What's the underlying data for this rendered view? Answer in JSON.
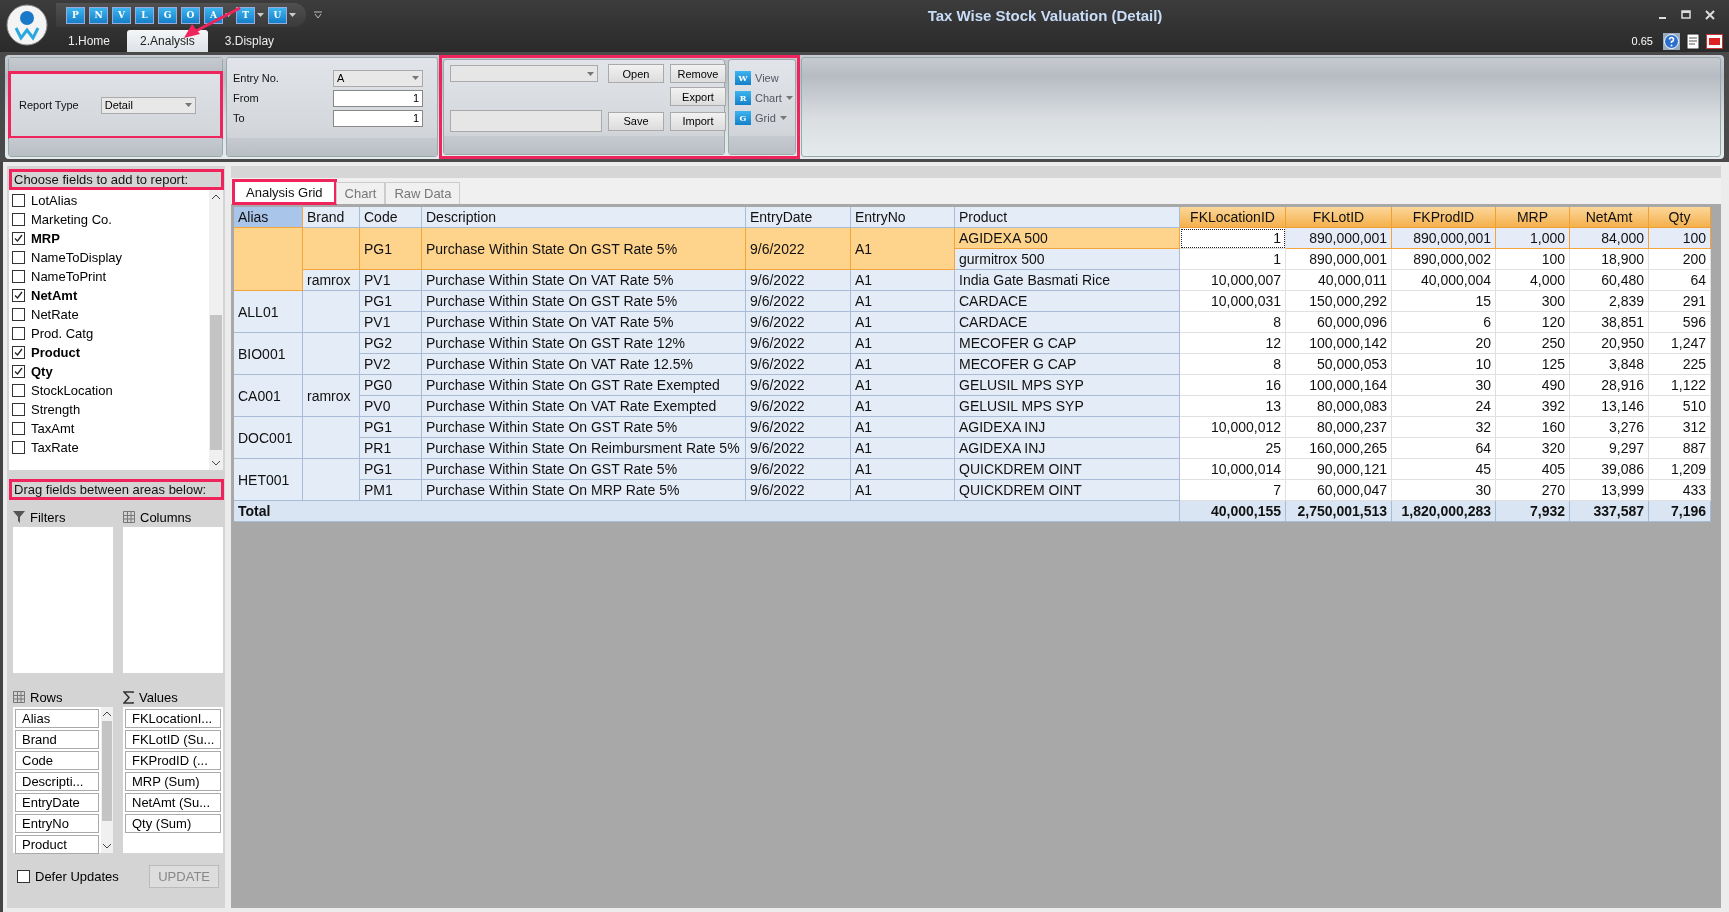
{
  "window": {
    "title": "Tax Wise Stock Valuation (Detail)"
  },
  "quick_access": [
    {
      "label": "P",
      "dropdown": false
    },
    {
      "label": "N",
      "dropdown": false
    },
    {
      "label": "V",
      "dropdown": false
    },
    {
      "label": "L",
      "dropdown": false
    },
    {
      "label": "G",
      "dropdown": false
    },
    {
      "label": "O",
      "dropdown": false
    },
    {
      "label": "A",
      "dropdown": true
    },
    {
      "label": "T",
      "dropdown": true
    },
    {
      "label": "U",
      "dropdown": true
    }
  ],
  "ribbon_tabs": [
    {
      "label": "1.Home",
      "selected": false
    },
    {
      "label": "2.Analysis",
      "selected": true
    },
    {
      "label": "3.Display",
      "selected": false
    }
  ],
  "version": "0.65",
  "report_type": {
    "label": "Report Type",
    "value": "Detail"
  },
  "entry_fields": [
    {
      "label": "Entry No.",
      "value": "A",
      "kind": "dropdown"
    },
    {
      "label": "From",
      "value": "1",
      "kind": "text"
    },
    {
      "label": "To",
      "value": "1",
      "kind": "text"
    }
  ],
  "layout_buttons": [
    "Open",
    "Remove",
    "Export",
    "Save",
    "Import"
  ],
  "view_buttons": [
    {
      "label": "View",
      "badge": "W",
      "dropdown": false
    },
    {
      "label": "Chart",
      "badge": "R",
      "dropdown": true
    },
    {
      "label": "Grid",
      "badge": "G",
      "dropdown": true
    }
  ],
  "field_list": {
    "title": "Choose fields to add to report:",
    "fields": [
      {
        "label": "LotAlias",
        "checked": false
      },
      {
        "label": "Marketing Co.",
        "checked": false
      },
      {
        "label": "MRP",
        "checked": true
      },
      {
        "label": "NameToDisplay",
        "checked": false
      },
      {
        "label": "NameToPrint",
        "checked": false
      },
      {
        "label": "NetAmt",
        "checked": true
      },
      {
        "label": "NetRate",
        "checked": false
      },
      {
        "label": "Prod. Catg",
        "checked": false
      },
      {
        "label": "Product",
        "checked": true
      },
      {
        "label": "Qty",
        "checked": true
      },
      {
        "label": "StockLocation",
        "checked": false
      },
      {
        "label": "Strength",
        "checked": false
      },
      {
        "label": "TaxAmt",
        "checked": false
      },
      {
        "label": "TaxRate",
        "checked": false
      }
    ]
  },
  "areas": {
    "title": "Drag fields between areas below:",
    "filters": "Filters",
    "columns": "Columns",
    "rows": {
      "label": "Rows",
      "items": [
        "Alias",
        "Brand",
        "Code",
        "Descripti...",
        "EntryDate",
        "EntryNo",
        "Product"
      ]
    },
    "values": {
      "label": "Values",
      "items": [
        "FKLocationI...",
        "FKLotID (Su...",
        "FKProdID (...",
        "MRP (Sum)",
        "NetAmt (Su...",
        "Qty (Sum)"
      ]
    }
  },
  "defer_updates": {
    "label": "Defer Updates",
    "checked": false
  },
  "update_button": {
    "label": "UPDATE",
    "disabled": true
  },
  "view_tabs": [
    {
      "label": "Analysis Grid",
      "selected": true
    },
    {
      "label": "Chart",
      "selected": false
    },
    {
      "label": "Raw Data",
      "selected": false
    }
  ],
  "table": {
    "row_columns": [
      {
        "label": "Alias",
        "selected": true
      },
      {
        "label": "Brand",
        "selected": false
      },
      {
        "label": "Code",
        "selected": false
      },
      {
        "label": "Description",
        "selected": false
      },
      {
        "label": "EntryDate",
        "selected": false
      },
      {
        "label": "EntryNo",
        "selected": false
      },
      {
        "label": "Product",
        "selected": false
      }
    ],
    "value_columns": [
      "FKLocationID",
      "FKLotID",
      "FKProdID",
      "MRP",
      "NetAmt",
      "Qty"
    ],
    "groups": [
      {
        "selected": true,
        "children": [
          {
            "selected": true,
            "children": [
              {
                "code": "PG1",
                "description": "Purchase Within State On GST Rate 5%",
                "entry_date": "9/6/2022",
                "entry_no": "A1",
                "selected": true,
                "children": [
                  {
                    "product": "AGIDEXA 500",
                    "selected": true,
                    "values": [
                      "1",
                      "890,000,001",
                      "890,000,001",
                      "1,000",
                      "84,000",
                      "100"
                    ]
                  },
                  {
                    "product": "gurmitrox 500",
                    "selected": false,
                    "values": [
                      "1",
                      "890,000,001",
                      "890,000,002",
                      "100",
                      "18,900",
                      "200"
                    ]
                  }
                ]
              }
            ]
          },
          {
            "brand": "ramrox",
            "selected": false,
            "children": [
              {
                "code": "PV1",
                "description": "Purchase Within State On VAT Rate 5%",
                "entry_date": "9/6/2022",
                "entry_no": "A1",
                "selected": false,
                "children": [
                  {
                    "product": "India Gate Basmati Rice",
                    "selected": false,
                    "values": [
                      "10,000,007",
                      "40,000,011",
                      "40,000,004",
                      "4,000",
                      "60,480",
                      "64"
                    ]
                  }
                ]
              }
            ]
          }
        ]
      },
      {
        "alias": "ALL01",
        "selected": false,
        "children": [
          {
            "selected": false,
            "children": [
              {
                "code": "PG1",
                "description": "Purchase Within State On GST Rate 5%",
                "entry_date": "9/6/2022",
                "entry_no": "A1",
                "selected": false,
                "children": [
                  {
                    "product": "CARDACE",
                    "selected": false,
                    "values": [
                      "10,000,031",
                      "150,000,292",
                      "15",
                      "300",
                      "2,839",
                      "291"
                    ]
                  }
                ]
              },
              {
                "code": "PV1",
                "description": "Purchase Within State On VAT Rate 5%",
                "entry_date": "9/6/2022",
                "entry_no": "A1",
                "selected": false,
                "children": [
                  {
                    "product": "CARDACE",
                    "selected": false,
                    "values": [
                      "8",
                      "60,000,096",
                      "6",
                      "120",
                      "38,851",
                      "596"
                    ]
                  }
                ]
              }
            ]
          }
        ]
      },
      {
        "alias": "BIO001",
        "selected": false,
        "children": [
          {
            "selected": false,
            "children": [
              {
                "code": "PG2",
                "description": "Purchase Within State On GST Rate 12%",
                "entry_date": "9/6/2022",
                "entry_no": "A1",
                "selected": false,
                "children": [
                  {
                    "product": "MECOFER G CAP",
                    "selected": false,
                    "values": [
                      "12",
                      "100,000,142",
                      "20",
                      "250",
                      "20,950",
                      "1,247"
                    ]
                  }
                ]
              },
              {
                "code": "PV2",
                "description": "Purchase Within State On VAT Rate 12.5%",
                "entry_date": "9/6/2022",
                "entry_no": "A1",
                "selected": false,
                "children": [
                  {
                    "product": "MECOFER G CAP",
                    "selected": false,
                    "values": [
                      "8",
                      "50,000,053",
                      "10",
                      "125",
                      "3,848",
                      "225"
                    ]
                  }
                ]
              }
            ]
          }
        ]
      },
      {
        "alias": "CA001",
        "selected": false,
        "children": [
          {
            "brand": "ramrox",
            "selected": false,
            "children": [
              {
                "code": "PG0",
                "description": "Purchase Within State On GST Rate Exempted",
                "entry_date": "9/6/2022",
                "entry_no": "A1",
                "selected": false,
                "children": [
                  {
                    "product": "GELUSIL MPS SYP",
                    "selected": false,
                    "values": [
                      "16",
                      "100,000,164",
                      "30",
                      "490",
                      "28,916",
                      "1,122"
                    ]
                  }
                ]
              },
              {
                "code": "PV0",
                "description": "Purchase Within State On VAT Rate Exempted",
                "entry_date": "9/6/2022",
                "entry_no": "A1",
                "selected": false,
                "children": [
                  {
                    "product": "GELUSIL MPS SYP",
                    "selected": false,
                    "values": [
                      "13",
                      "80,000,083",
                      "24",
                      "392",
                      "13,146",
                      "510"
                    ]
                  }
                ]
              }
            ]
          }
        ]
      },
      {
        "alias": "DOC001",
        "selected": false,
        "children": [
          {
            "selected": false,
            "children": [
              {
                "code": "PG1",
                "description": "Purchase Within State On GST Rate 5%",
                "entry_date": "9/6/2022",
                "entry_no": "A1",
                "selected": false,
                "children": [
                  {
                    "product": "AGIDEXA INJ",
                    "selected": false,
                    "values": [
                      "10,000,012",
                      "80,000,237",
                      "32",
                      "160",
                      "3,276",
                      "312"
                    ]
                  }
                ]
              },
              {
                "code": "PR1",
                "description": "Purchase Within State On Reimbursment Rate 5%",
                "entry_date": "9/6/2022",
                "entry_no": "A1",
                "selected": false,
                "children": [
                  {
                    "product": "AGIDEXA INJ",
                    "selected": false,
                    "values": [
                      "25",
                      "160,000,265",
                      "64",
                      "320",
                      "9,297",
                      "887"
                    ]
                  }
                ]
              }
            ]
          }
        ]
      },
      {
        "alias": "HET001",
        "selected": false,
        "children": [
          {
            "selected": false,
            "children": [
              {
                "code": "PG1",
                "description": "Purchase Within State On GST Rate 5%",
                "entry_date": "9/6/2022",
                "entry_no": "A1",
                "selected": false,
                "children": [
                  {
                    "product": "QUICKDREM OINT",
                    "selected": false,
                    "values": [
                      "10,000,014",
                      "90,000,121",
                      "45",
                      "405",
                      "39,086",
                      "1,209"
                    ]
                  }
                ]
              },
              {
                "code": "PM1",
                "description": "Purchase Within State On MRP Rate 5%",
                "entry_date": "9/6/2022",
                "entry_no": "A1",
                "selected": false,
                "children": [
                  {
                    "product": "QUICKDREM OINT",
                    "selected": false,
                    "values": [
                      "7",
                      "60,000,047",
                      "30",
                      "270",
                      "13,999",
                      "433"
                    ]
                  }
                ]
              }
            ]
          }
        ]
      }
    ],
    "total": {
      "label": "Total",
      "values": [
        "40,000,155",
        "2,750,001,513",
        "1,820,000,283",
        "7,932",
        "337,587",
        "7,196"
      ]
    }
  }
}
